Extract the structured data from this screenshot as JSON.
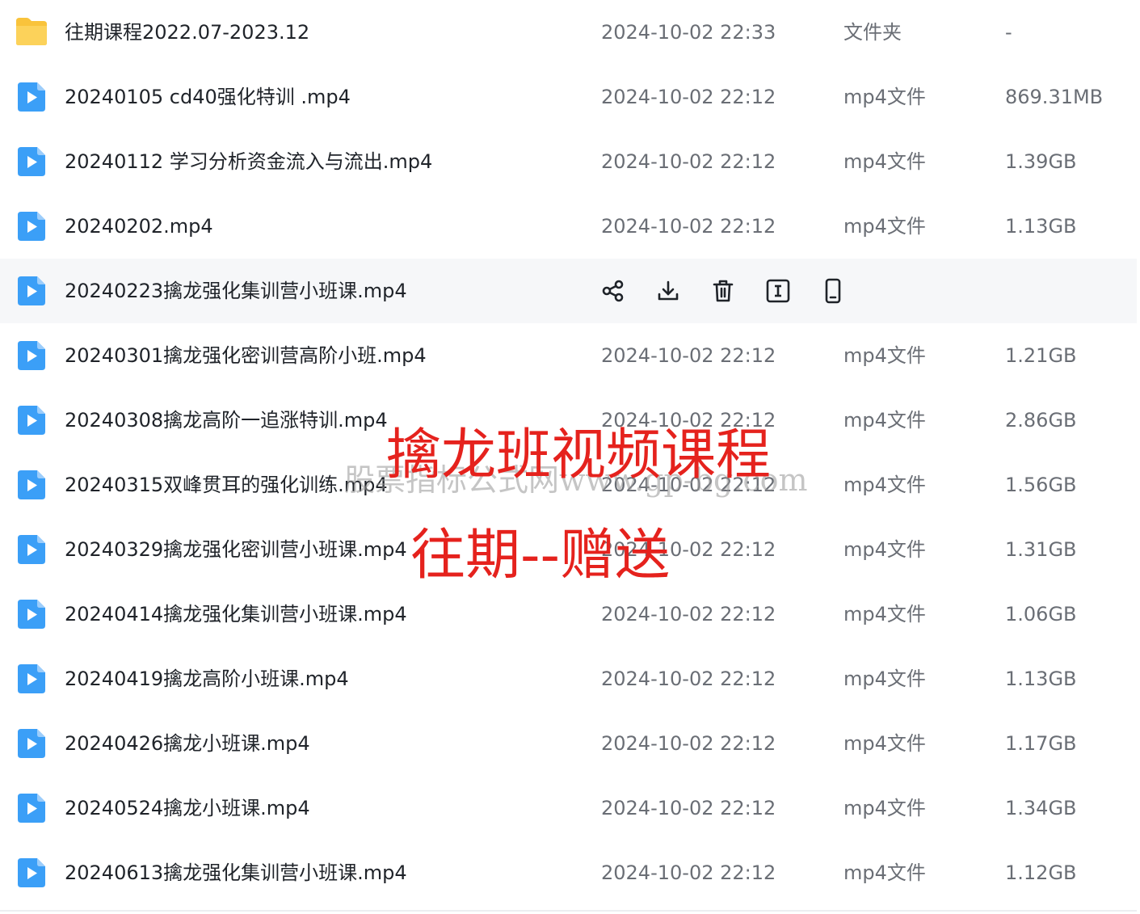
{
  "colors": {
    "folder": "#f9c33b",
    "video_icon": "#3b9ff7",
    "overlay_red": "#e5221d",
    "row_hover": "#f6f7f9"
  },
  "files": [
    {
      "icon": "folder-icon",
      "name": "往期课程2022.07-2023.12",
      "date": "2024-10-02 22:33",
      "type": "文件夹",
      "size": "-"
    },
    {
      "icon": "video-file-icon",
      "name": "20240105  cd40强化特训 .mp4",
      "date": "2024-10-02 22:12",
      "type": "mp4文件",
      "size": "869.31MB"
    },
    {
      "icon": "video-file-icon",
      "name": "20240112 学习分析资金流入与流出.mp4",
      "date": "2024-10-02 22:12",
      "type": "mp4文件",
      "size": "1.39GB"
    },
    {
      "icon": "video-file-icon",
      "name": "20240202.mp4",
      "date": "2024-10-02 22:12",
      "type": "mp4文件",
      "size": "1.13GB"
    },
    {
      "icon": "video-file-icon",
      "name": "20240223擒龙强化集训营小班课.mp4",
      "date": "",
      "type": "",
      "size": "",
      "hovered": true
    },
    {
      "icon": "video-file-icon",
      "name": "20240301擒龙强化密训营高阶小班.mp4",
      "date": "2024-10-02 22:12",
      "type": "mp4文件",
      "size": "1.21GB"
    },
    {
      "icon": "video-file-icon",
      "name": "20240308擒龙高阶一追涨特训.mp4",
      "date": "2024-10-02 22:12",
      "type": "mp4文件",
      "size": "2.86GB"
    },
    {
      "icon": "video-file-icon",
      "name": "20240315双峰贯耳的强化训练.mp4",
      "date": "2024-10-02 22:12",
      "type": "mp4文件",
      "size": "1.56GB"
    },
    {
      "icon": "video-file-icon",
      "name": "20240329擒龙强化密训营小班课.mp4",
      "date": "2024-10-02 22:12",
      "type": "mp4文件",
      "size": "1.31GB"
    },
    {
      "icon": "video-file-icon",
      "name": "20240414擒龙强化集训营小班课.mp4",
      "date": "2024-10-02 22:12",
      "type": "mp4文件",
      "size": "1.06GB"
    },
    {
      "icon": "video-file-icon",
      "name": "20240419擒龙高阶小班课.mp4",
      "date": "2024-10-02 22:12",
      "type": "mp4文件",
      "size": "1.13GB"
    },
    {
      "icon": "video-file-icon",
      "name": "20240426擒龙小班课.mp4",
      "date": "2024-10-02 22:12",
      "type": "mp4文件",
      "size": "1.17GB"
    },
    {
      "icon": "video-file-icon",
      "name": "20240524擒龙小班课.mp4",
      "date": "2024-10-02 22:12",
      "type": "mp4文件",
      "size": "1.34GB"
    },
    {
      "icon": "video-file-icon",
      "name": "20240613擒龙强化集训营小班课.mp4",
      "date": "2024-10-02 22:12",
      "type": "mp4文件",
      "size": "1.12GB"
    }
  ],
  "row_actions": [
    "share-icon",
    "download-icon",
    "trash-icon",
    "rename-icon",
    "mobile-icon"
  ],
  "overlay": {
    "title": "擒龙班视频课程",
    "subtitle": "往期--赠送",
    "watermark": "股票指标公式网www.gp-bg.com"
  }
}
